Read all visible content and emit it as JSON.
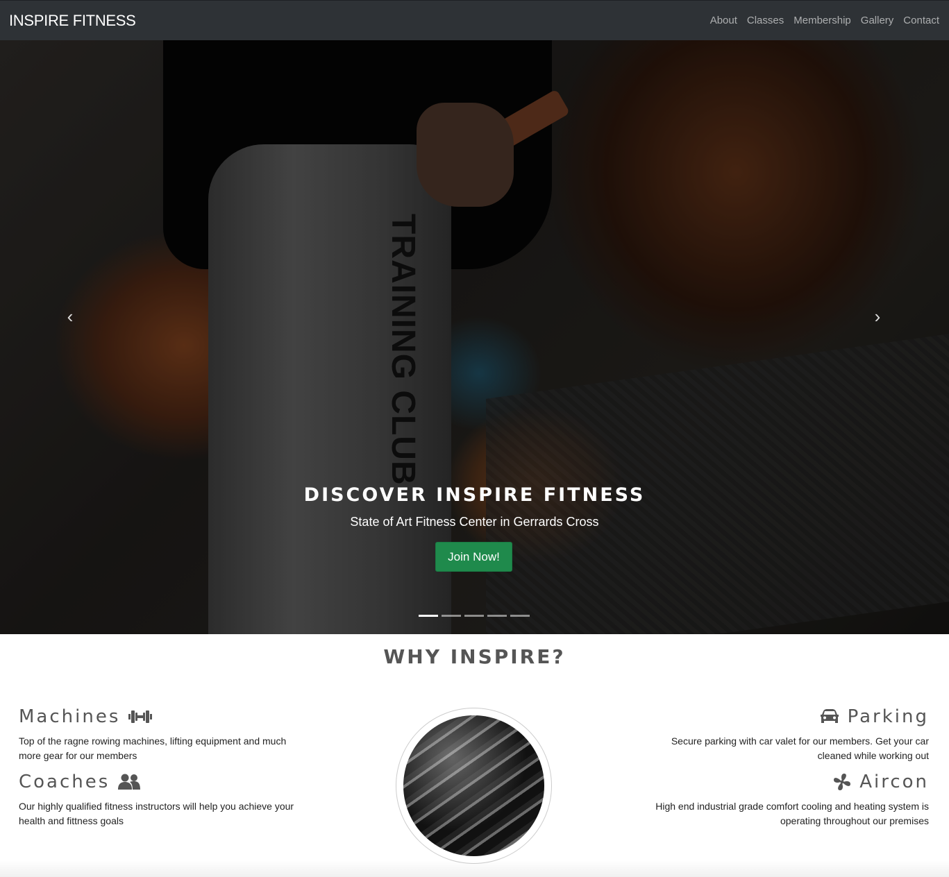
{
  "navbar": {
    "brand": "INSPIRE FITNESS",
    "links": [
      "About",
      "Classes",
      "Membership",
      "Gallery",
      "Contact"
    ]
  },
  "hero": {
    "leg_print": "TRAINING CLUB",
    "title": "DISCOVER INSPIRE FITNESS",
    "subtitle": "State of Art Fitness Center in Gerrards Cross",
    "cta_label": "Join Now!",
    "prev_icon": "chevron-left-icon",
    "next_icon": "chevron-right-icon",
    "slide_count": 5,
    "active_slide": 1
  },
  "why": {
    "title": "WHY INSPIRE?",
    "features": {
      "machines": {
        "title": "Machines",
        "icon": "dumbbell-icon",
        "text": "Top of the ragne rowing machines, lifting equipment and much more gear for our members"
      },
      "coaches": {
        "title": "Coaches",
        "icon": "users-icon",
        "text": "Our highly qualified fitness instructors will help you achieve your health and fittness goals"
      },
      "parking": {
        "title": "Parking",
        "icon": "car-icon",
        "text": "Secure parking with car valet for our members. Get your car cleaned while working out"
      },
      "aircon": {
        "title": "Aircon",
        "icon": "fan-icon",
        "text": "High end industrial grade comfort cooling and heating system is operating throughout our premises"
      }
    }
  },
  "colors": {
    "navbar": "#2e3236",
    "cta": "#1f8a4c",
    "heading": "#555555"
  }
}
